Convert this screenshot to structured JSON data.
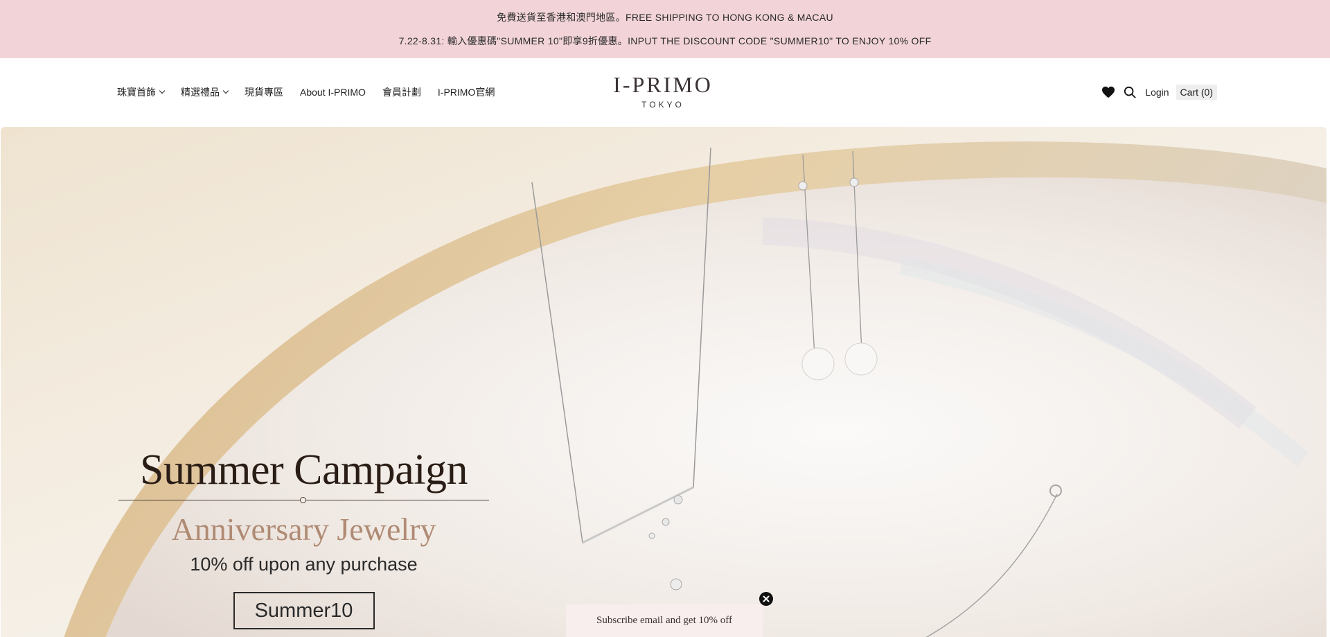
{
  "announcement": {
    "line1": "免費送貨至香港和澳門地區。FREE SHIPPING TO HONG KONG & MACAU",
    "line2": "7.22-8.31: 輸入優惠碼\"SUMMER 10\"即享9折優惠。INPUT THE DISCOUNT CODE \"SUMMER10\" TO ENJOY 10% OFF"
  },
  "nav": {
    "items": [
      {
        "label": "珠寶首飾",
        "has_dropdown": true
      },
      {
        "label": "精選禮品",
        "has_dropdown": true
      },
      {
        "label": "現貨專區",
        "has_dropdown": false
      },
      {
        "label": "About I-PRIMO",
        "has_dropdown": false
      },
      {
        "label": "會員計劃",
        "has_dropdown": false
      },
      {
        "label": "I-PRIMO官網",
        "has_dropdown": false
      }
    ]
  },
  "logo": {
    "main": "I-PRIMO",
    "sub": "TOKYO"
  },
  "header_right": {
    "wishlist_icon": "heart-icon",
    "search_icon": "search-icon",
    "login_label": "Login",
    "cart_label": "Cart (0)"
  },
  "hero": {
    "title": "Summer Campaign",
    "subtitle": "Anniversary Jewelry",
    "offer": "10% off upon any purchase",
    "code": "Summer10"
  },
  "subscribe": {
    "text": "Subscribe email and get 10% off",
    "close_icon": "close-icon"
  },
  "colors": {
    "announcement_bg": "#f2d4d8",
    "subtitle_accent": "#b08b74",
    "cart_bg": "#eeeeee"
  }
}
